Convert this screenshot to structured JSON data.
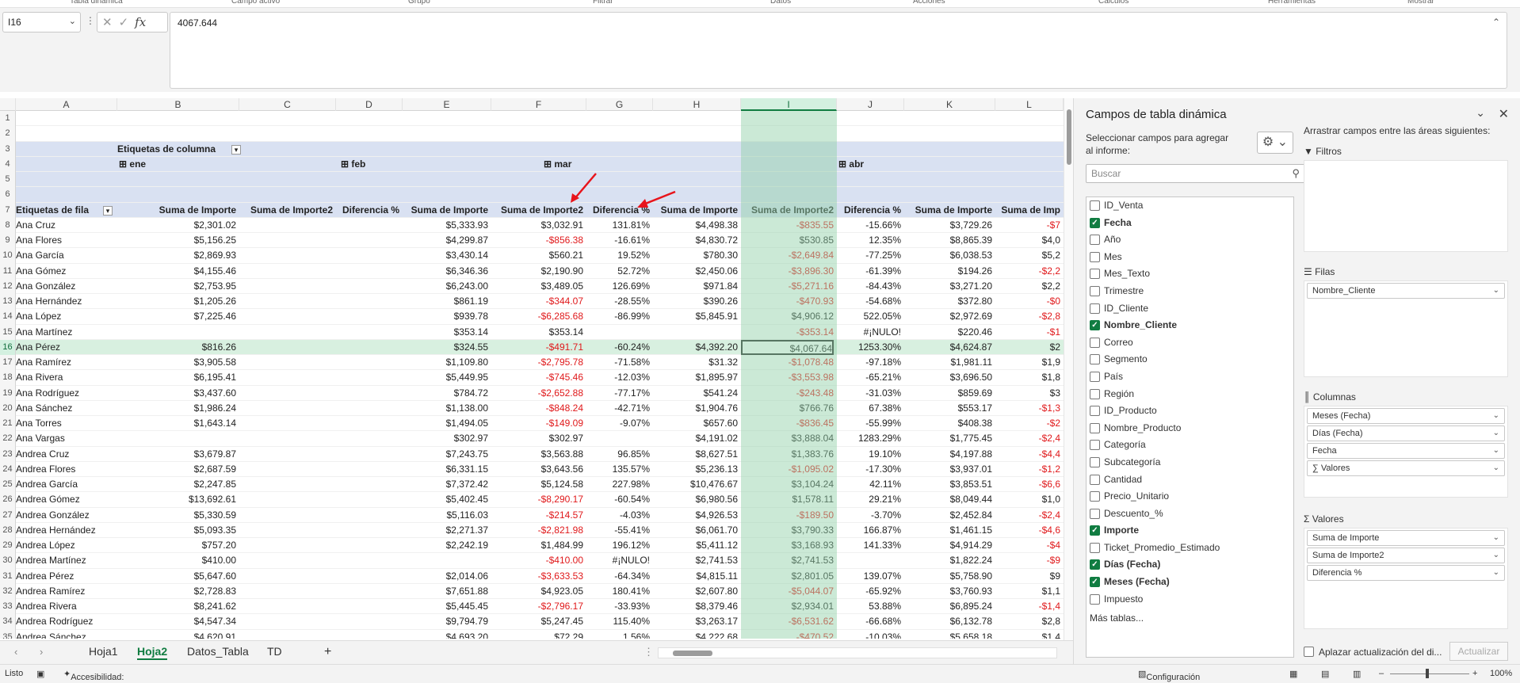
{
  "ribbon": {
    "groups": [
      "Tabla dinámica",
      "Campo activo",
      "Grupo",
      "Filtrar",
      "Datos",
      "Acciones",
      "Cálculos",
      "Herramientas",
      "Mostrar"
    ]
  },
  "formula_bar": {
    "name_box": "I16",
    "formula": "4067.644"
  },
  "columns": [
    "A",
    "B",
    "C",
    "D",
    "E",
    "F",
    "G",
    "H",
    "I",
    "J",
    "K",
    "L"
  ],
  "selected_column": "I",
  "selected_row": 16,
  "rows": [
    {
      "n": 1,
      "cells": {}
    },
    {
      "n": 2,
      "cells": {}
    },
    {
      "n": 3,
      "pivot": true,
      "cells": {
        "B": "Etiquetas de columna"
      }
    },
    {
      "n": 4,
      "pivot": true,
      "cells": {
        "B": "ene",
        "E": "feb",
        "H": "mar",
        "J": "abr"
      }
    },
    {
      "n": 5,
      "pivot": true,
      "cells": {}
    },
    {
      "n": 6,
      "pivot": true,
      "cells": {}
    },
    {
      "n": 7,
      "pivot": true,
      "header": true,
      "cells": {
        "A": "Etiquetas de fila",
        "B": "Suma de Importe",
        "C": "Suma de Importe2",
        "D": "Diferencia %",
        "E": "Suma de Importe",
        "F": "Suma de Importe2",
        "G": "Diferencia %",
        "H": "Suma de Importe",
        "I": "Suma de Importe2",
        "J": "Diferencia %",
        "K": "Suma de Importe",
        "L": "Suma de Imp"
      }
    },
    {
      "n": 8,
      "cells": {
        "A": "Ana Cruz",
        "B": "$2,301.02",
        "E": "$5,333.93",
        "F": "$3,032.91",
        "G": "131.81%",
        "H": "$4,498.38",
        "I": "-$835.55",
        "J": "-15.66%",
        "K": "$3,729.26",
        "L": "-$7"
      }
    },
    {
      "n": 9,
      "cells": {
        "A": "Ana Flores",
        "B": "$5,156.25",
        "E": "$4,299.87",
        "F": "-$856.38",
        "G": "-16.61%",
        "H": "$4,830.72",
        "I": "$530.85",
        "J": "12.35%",
        "K": "$8,865.39",
        "L": "$4,0"
      }
    },
    {
      "n": 10,
      "cells": {
        "A": "Ana García",
        "B": "$2,869.93",
        "E": "$3,430.14",
        "F": "$560.21",
        "G": "19.52%",
        "H": "$780.30",
        "I": "-$2,649.84",
        "J": "-77.25%",
        "K": "$6,038.53",
        "L": "$5,2"
      }
    },
    {
      "n": 11,
      "cells": {
        "A": "Ana Gómez",
        "B": "$4,155.46",
        "E": "$6,346.36",
        "F": "$2,190.90",
        "G": "52.72%",
        "H": "$2,450.06",
        "I": "-$3,896.30",
        "J": "-61.39%",
        "K": "$194.26",
        "L": "-$2,2"
      }
    },
    {
      "n": 12,
      "cells": {
        "A": "Ana González",
        "B": "$2,753.95",
        "E": "$6,243.00",
        "F": "$3,489.05",
        "G": "126.69%",
        "H": "$971.84",
        "I": "-$5,271.16",
        "J": "-84.43%",
        "K": "$3,271.20",
        "L": "$2,2"
      }
    },
    {
      "n": 13,
      "cells": {
        "A": "Ana Hernández",
        "B": "$1,205.26",
        "E": "$861.19",
        "F": "-$344.07",
        "G": "-28.55%",
        "H": "$390.26",
        "I": "-$470.93",
        "J": "-54.68%",
        "K": "$372.80",
        "L": "-$0"
      }
    },
    {
      "n": 14,
      "cells": {
        "A": "Ana López",
        "B": "$7,225.46",
        "E": "$939.78",
        "F": "-$6,285.68",
        "G": "-86.99%",
        "H": "$5,845.91",
        "I": "$4,906.12",
        "J": "522.05%",
        "K": "$2,972.69",
        "L": "-$2,8"
      }
    },
    {
      "n": 15,
      "cells": {
        "A": "Ana Martínez",
        "E": "$353.14",
        "F": "$353.14",
        "I": "-$353.14",
        "J": "#¡NULO!",
        "K": "$220.46",
        "L": "-$1"
      }
    },
    {
      "n": 16,
      "cells": {
        "A": "Ana Pérez",
        "B": "$816.26",
        "E": "$324.55",
        "F": "-$491.71",
        "G": "-60.24%",
        "H": "$4,392.20",
        "I": "$4,067.64",
        "J": "1253.30%",
        "K": "$4,624.87",
        "L": "$2"
      }
    },
    {
      "n": 17,
      "cells": {
        "A": "Ana Ramírez",
        "B": "$3,905.58",
        "E": "$1,109.80",
        "F": "-$2,795.78",
        "G": "-71.58%",
        "H": "$31.32",
        "I": "-$1,078.48",
        "J": "-97.18%",
        "K": "$1,981.11",
        "L": "$1,9"
      }
    },
    {
      "n": 18,
      "cells": {
        "A": "Ana Rivera",
        "B": "$6,195.41",
        "E": "$5,449.95",
        "F": "-$745.46",
        "G": "-12.03%",
        "H": "$1,895.97",
        "I": "-$3,553.98",
        "J": "-65.21%",
        "K": "$3,696.50",
        "L": "$1,8"
      }
    },
    {
      "n": 19,
      "cells": {
        "A": "Ana Rodríguez",
        "B": "$3,437.60",
        "E": "$784.72",
        "F": "-$2,652.88",
        "G": "-77.17%",
        "H": "$541.24",
        "I": "-$243.48",
        "J": "-31.03%",
        "K": "$859.69",
        "L": "$3"
      }
    },
    {
      "n": 20,
      "cells": {
        "A": "Ana Sánchez",
        "B": "$1,986.24",
        "E": "$1,138.00",
        "F": "-$848.24",
        "G": "-42.71%",
        "H": "$1,904.76",
        "I": "$766.76",
        "J": "67.38%",
        "K": "$553.17",
        "L": "-$1,3"
      }
    },
    {
      "n": 21,
      "cells": {
        "A": "Ana Torres",
        "B": "$1,643.14",
        "E": "$1,494.05",
        "F": "-$149.09",
        "G": "-9.07%",
        "H": "$657.60",
        "I": "-$836.45",
        "J": "-55.99%",
        "K": "$408.38",
        "L": "-$2"
      }
    },
    {
      "n": 22,
      "cells": {
        "A": "Ana Vargas",
        "E": "$302.97",
        "F": "$302.97",
        "H": "$4,191.02",
        "I": "$3,888.04",
        "J": "1283.29%",
        "K": "$1,775.45",
        "L": "-$2,4"
      }
    },
    {
      "n": 23,
      "cells": {
        "A": "Andrea Cruz",
        "B": "$3,679.87",
        "E": "$7,243.75",
        "F": "$3,563.88",
        "G": "96.85%",
        "H": "$8,627.51",
        "I": "$1,383.76",
        "J": "19.10%",
        "K": "$4,197.88",
        "L": "-$4,4"
      }
    },
    {
      "n": 24,
      "cells": {
        "A": "Andrea Flores",
        "B": "$2,687.59",
        "E": "$6,331.15",
        "F": "$3,643.56",
        "G": "135.57%",
        "H": "$5,236.13",
        "I": "-$1,095.02",
        "J": "-17.30%",
        "K": "$3,937.01",
        "L": "-$1,2"
      }
    },
    {
      "n": 25,
      "cells": {
        "A": "Andrea García",
        "B": "$2,247.85",
        "E": "$7,372.42",
        "F": "$5,124.58",
        "G": "227.98%",
        "H": "$10,476.67",
        "I": "$3,104.24",
        "J": "42.11%",
        "K": "$3,853.51",
        "L": "-$6,6"
      }
    },
    {
      "n": 26,
      "cells": {
        "A": "Andrea Gómez",
        "B": "$13,692.61",
        "E": "$5,402.45",
        "F": "-$8,290.17",
        "G": "-60.54%",
        "H": "$6,980.56",
        "I": "$1,578.11",
        "J": "29.21%",
        "K": "$8,049.44",
        "L": "$1,0"
      }
    },
    {
      "n": 27,
      "cells": {
        "A": "Andrea González",
        "B": "$5,330.59",
        "E": "$5,116.03",
        "F": "-$214.57",
        "G": "-4.03%",
        "H": "$4,926.53",
        "I": "-$189.50",
        "J": "-3.70%",
        "K": "$2,452.84",
        "L": "-$2,4"
      }
    },
    {
      "n": 28,
      "cells": {
        "A": "Andrea Hernández",
        "B": "$5,093.35",
        "E": "$2,271.37",
        "F": "-$2,821.98",
        "G": "-55.41%",
        "H": "$6,061.70",
        "I": "$3,790.33",
        "J": "166.87%",
        "K": "$1,461.15",
        "L": "-$4,6"
      }
    },
    {
      "n": 29,
      "cells": {
        "A": "Andrea López",
        "B": "$757.20",
        "E": "$2,242.19",
        "F": "$1,484.99",
        "G": "196.12%",
        "H": "$5,411.12",
        "I": "$3,168.93",
        "J": "141.33%",
        "K": "$4,914.29",
        "L": "-$4"
      }
    },
    {
      "n": 30,
      "cells": {
        "A": "Andrea Martínez",
        "B": "$410.00",
        "F": "-$410.00",
        "G": "#¡NULO!",
        "H": "$2,741.53",
        "I": "$2,741.53",
        "K": "$1,822.24",
        "L": "-$9"
      }
    },
    {
      "n": 31,
      "cells": {
        "A": "Andrea Pérez",
        "B": "$5,647.60",
        "E": "$2,014.06",
        "F": "-$3,633.53",
        "G": "-64.34%",
        "H": "$4,815.11",
        "I": "$2,801.05",
        "J": "139.07%",
        "K": "$5,758.90",
        "L": "$9"
      }
    },
    {
      "n": 32,
      "cells": {
        "A": "Andrea Ramírez",
        "B": "$2,728.83",
        "E": "$7,651.88",
        "F": "$4,923.05",
        "G": "180.41%",
        "H": "$2,607.80",
        "I": "-$5,044.07",
        "J": "-65.92%",
        "K": "$3,760.93",
        "L": "$1,1"
      }
    },
    {
      "n": 33,
      "cells": {
        "A": "Andrea Rivera",
        "B": "$8,241.62",
        "E": "$5,445.45",
        "F": "-$2,796.17",
        "G": "-33.93%",
        "H": "$8,379.46",
        "I": "$2,934.01",
        "J": "53.88%",
        "K": "$6,895.24",
        "L": "-$1,4"
      }
    },
    {
      "n": 34,
      "cells": {
        "A": "Andrea Rodríguez",
        "B": "$4,547.34",
        "E": "$9,794.79",
        "F": "$5,247.45",
        "G": "115.40%",
        "H": "$3,263.17",
        "I": "-$6,531.62",
        "J": "-66.68%",
        "K": "$6,132.78",
        "L": "$2,8"
      }
    },
    {
      "n": 35,
      "cells": {
        "A": "Andrea Sánchez",
        "B": "$4,620.91",
        "E": "$4,693.20",
        "F": "$72.29",
        "G": "1.56%",
        "H": "$4,222.68",
        "I": "-$470.52",
        "J": "-10.03%",
        "K": "$5,658.18",
        "L": "$1,4"
      }
    }
  ],
  "sheet_tabs": [
    "Hoja1",
    "Hoja2",
    "Datos_Tabla",
    "TD"
  ],
  "active_tab": "Hoja2",
  "status": {
    "ready": "Listo",
    "accessibility": "Accesibilidad: es necesario investigar",
    "display_settings": "Configuración de visualización",
    "zoom": "100%"
  },
  "pivot_panel": {
    "title": "Campos de tabla dinámica",
    "subtitle": "Seleccionar campos para agregar al informe:",
    "search_placeholder": "Buscar",
    "drag_hint": "Arrastrar campos entre las áreas siguientes:",
    "fields": [
      {
        "name": "ID_Venta",
        "checked": false
      },
      {
        "name": "Fecha",
        "checked": true
      },
      {
        "name": "Año",
        "checked": false
      },
      {
        "name": "Mes",
        "checked": false
      },
      {
        "name": "Mes_Texto",
        "checked": false
      },
      {
        "name": "Trimestre",
        "checked": false
      },
      {
        "name": "ID_Cliente",
        "checked": false
      },
      {
        "name": "Nombre_Cliente",
        "checked": true
      },
      {
        "name": "Correo",
        "checked": false
      },
      {
        "name": "Segmento",
        "checked": false
      },
      {
        "name": "País",
        "checked": false
      },
      {
        "name": "Región",
        "checked": false
      },
      {
        "name": "ID_Producto",
        "checked": false
      },
      {
        "name": "Nombre_Producto",
        "checked": false
      },
      {
        "name": "Categoría",
        "checked": false
      },
      {
        "name": "Subcategoría",
        "checked": false
      },
      {
        "name": "Cantidad",
        "checked": false
      },
      {
        "name": "Precio_Unitario",
        "checked": false
      },
      {
        "name": "Descuento_%",
        "checked": false
      },
      {
        "name": "Importe",
        "checked": true
      },
      {
        "name": "Ticket_Promedio_Estimado",
        "checked": false
      },
      {
        "name": "Días (Fecha)",
        "checked": true
      },
      {
        "name": "Meses (Fecha)",
        "checked": true
      },
      {
        "name": "Impuesto",
        "checked": false
      }
    ],
    "more_tables": "Más tablas...",
    "areas": {
      "filters": {
        "label": "Filtros",
        "items": []
      },
      "rows": {
        "label": "Filas",
        "items": [
          "Nombre_Cliente"
        ]
      },
      "columns": {
        "label": "Columnas",
        "items": [
          "Meses (Fecha)",
          "Días (Fecha)",
          "Fecha",
          "∑ Valores"
        ]
      },
      "values": {
        "label": "Valores",
        "items": [
          "Suma de Importe",
          "Suma de Importe2",
          "Diferencia %"
        ]
      }
    },
    "defer_label": "Aplazar actualización del di...",
    "update_button": "Actualizar"
  },
  "accent": "#107c41",
  "negative_color": "#e0191b",
  "annotation_color": "#e8141b"
}
